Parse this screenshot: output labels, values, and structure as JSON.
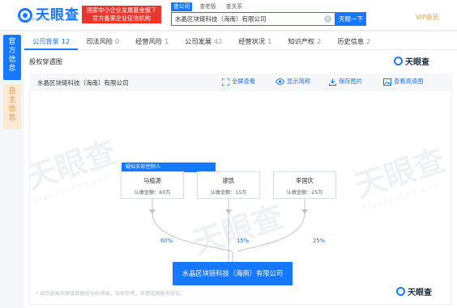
{
  "header": {
    "logo_text": "天眼查",
    "logo_sub": "TianYanCha.com",
    "badge_line1": "国家中小企业发展基金旗下",
    "badge_line2": "官方备案企业征信机构",
    "search_tabs": [
      "查公司",
      "查老板",
      "查关系"
    ],
    "search_value": "水晶区块链科技（海南）有限公司",
    "search_button": "天眼一下",
    "vip": "VIP会员"
  },
  "side_tabs": [
    {
      "label": "官方信息",
      "chars": [
        "官",
        "方",
        "信",
        "息"
      ]
    },
    {
      "label": "自主信息",
      "chars": [
        "自",
        "主",
        "信",
        "息"
      ]
    }
  ],
  "nav": [
    {
      "label": "公司背景",
      "count": "12"
    },
    {
      "label": "司法风险",
      "count": "0"
    },
    {
      "label": "经营风险",
      "count": "1"
    },
    {
      "label": "公司发展",
      "count": "42"
    },
    {
      "label": "经营状况",
      "count": "1"
    },
    {
      "label": "知识产权",
      "count": "2"
    },
    {
      "label": "历史信息",
      "count": "2"
    }
  ],
  "section": {
    "title": "股权穿透图",
    "brand": "天眼查"
  },
  "toolbar": {
    "company": "水晶区块链科技（海南）有限公司",
    "actions": [
      "全屏查看",
      "显示简称",
      "保存图片",
      "查看高清图"
    ]
  },
  "graph": {
    "controller_tag": "疑似实际控制人",
    "holders": [
      {
        "name": "马植源",
        "capital": "认缴金额：60万",
        "percent": "60%"
      },
      {
        "name": "廖凯",
        "capital": "认缴金额：15万",
        "percent": "15%"
      },
      {
        "name": "李国庆",
        "capital": "认缴金额：25万",
        "percent": "25%"
      }
    ],
    "target": "水晶区块链科技（海南）有限公司",
    "watermark": "天眼查",
    "watermark_sub": "TianYanCha.com"
  },
  "footer": {
    "note": "* 该信息由天眼查数据库分析得出，仅供参考，详情见网服务协议。",
    "brand": "天眼查"
  },
  "colors": {
    "primary": "#1677ff",
    "badge_red": "#e8372e",
    "vip": "#e39b3b",
    "side_inactive_bg": "#fbe9d4"
  }
}
